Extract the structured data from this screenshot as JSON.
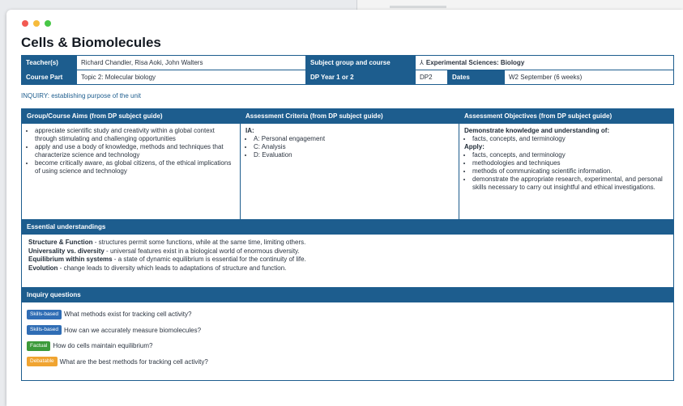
{
  "page": {
    "title": "Cells & Biomolecules"
  },
  "info": {
    "teachers_label": "Teacher(s)",
    "teachers_value": "Richard Chandler, Risa Aoki, John Walters",
    "subject_label": "Subject group and course",
    "subject_value": "Experimental Sciences: Biology",
    "course_part_label": "Course Part",
    "course_part_value": "Topic 2: Molecular biology",
    "dp_year_label": "DP Year 1 or 2",
    "dp_year_value": "DP2",
    "dates_label": "Dates",
    "dates_value": "W2 September (6 weeks)"
  },
  "inquiry_heading": "INQUIRY: establishing purpose of the unit",
  "columns": {
    "aims_header": "Group/Course Aims (from DP subject guide)",
    "criteria_header": "Assessment Criteria (from DP subject guide)",
    "objectives_header": "Assessment Objectives (from DP subject guide)"
  },
  "aims": [
    "appreciate scientific study and creativity within a global context through stimulating and challenging opportunities",
    "apply and use a body of knowledge, methods and techniques that characterize science and technology",
    "become critically aware, as global citizens, of the ethical implications of using science and technology"
  ],
  "criteria": {
    "heading": "IA:",
    "items": [
      "A: Personal engagement",
      "C: Analysis",
      "D: Evaluation"
    ]
  },
  "objectives": {
    "demonstrate_heading": "Demonstrate knowledge and understanding of:",
    "demonstrate_items": [
      "facts, concepts, and terminology"
    ],
    "apply_heading": "Apply:",
    "apply_items": [
      "facts, concepts, and terminology",
      "methodologies and techniques",
      "methods of communicating scientific information.",
      "demonstrate the appropriate research, experimental, and personal skills necessary to carry out insightful and ethical investigations."
    ]
  },
  "essential": {
    "header": "Essential understandings",
    "items": [
      {
        "term": "Structure & Function",
        "text": " - structures permit some functions, while at the same time, limiting others."
      },
      {
        "term": "Universality vs. diversity",
        "text": " - universal features exist in a biological world of enormous diversity."
      },
      {
        "term": "Equilibrium within systems",
        "text": " - a state of dynamic equilibrium is essential for the continuity of life."
      },
      {
        "term": "Evolution",
        "text": " - change leads to diversity which leads to adaptations of structure and function."
      }
    ]
  },
  "inquiry_questions": {
    "header": "Inquiry questions",
    "items": [
      {
        "badge": "Skills-based",
        "badge_color": "#2f6db5",
        "text": "What methods exist for tracking cell activity?"
      },
      {
        "badge": "Skills-based",
        "badge_color": "#2f6db5",
        "text": "How can we accurately measure biomolecules?"
      },
      {
        "badge": "Factual",
        "badge_color": "#3c9a3a",
        "text": "How do cells maintain equilibrium?"
      },
      {
        "badge": "Debatable",
        "badge_color": "#f0a431",
        "text": "What are the best methods for tracking cell activity?"
      }
    ]
  }
}
